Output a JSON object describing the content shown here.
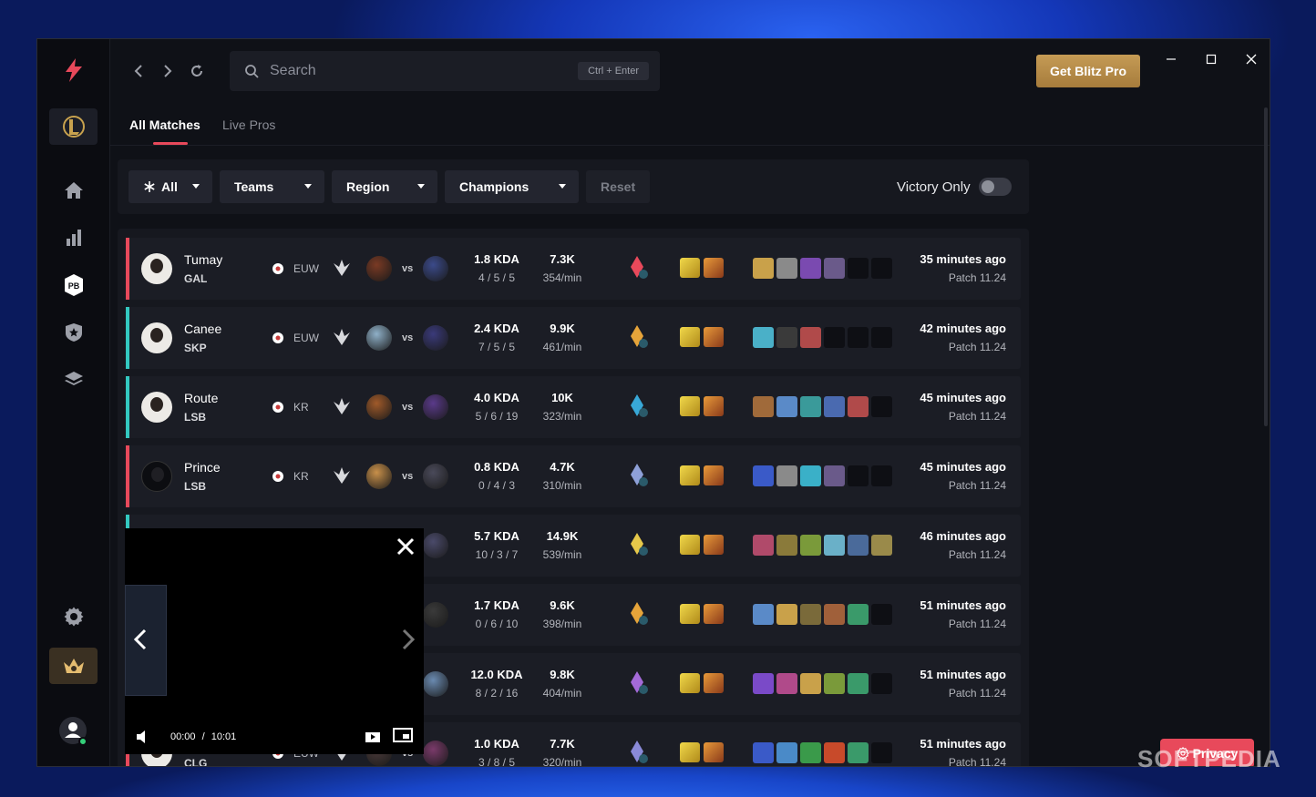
{
  "app": {
    "name": "Blitz"
  },
  "colors": {
    "accent": "#e8495b",
    "loss": "#e8495b",
    "win": "#33c8c0",
    "gold": "#c59b55",
    "bg": "#0f1117"
  },
  "sidebar": {
    "items": [
      {
        "icon": "blitz-logo-icon"
      },
      {
        "icon": "league-of-legends-icon"
      },
      {
        "icon": "home-icon"
      },
      {
        "icon": "stats-icon"
      },
      {
        "icon": "probuilds-icon",
        "label": "PB"
      },
      {
        "icon": "shield-star-icon"
      },
      {
        "icon": "layers-icon"
      },
      {
        "icon": "gear-icon"
      },
      {
        "icon": "crown-icon"
      },
      {
        "icon": "user-icon"
      }
    ]
  },
  "header": {
    "search_placeholder": "Search",
    "search_shortcut": "Ctrl + Enter",
    "get_pro": "Get Blitz Pro"
  },
  "tabs": [
    {
      "label": "All Matches",
      "active": true
    },
    {
      "label": "Live Pros",
      "active": false
    }
  ],
  "filters": {
    "all": "All",
    "teams": "Teams",
    "region": "Region",
    "champions": "Champions",
    "reset": "Reset",
    "victory_only": "Victory Only",
    "victory_on": false
  },
  "matches": [
    {
      "name": "Tumay",
      "team": "GAL",
      "region": "EUW",
      "result": "loss",
      "kda": "1.8 KDA",
      "kda_split": "4 / 5 / 5",
      "dmg": "7.3K",
      "dmg_rate": "354/min",
      "time": "35 minutes ago",
      "patch": "Patch 11.24"
    },
    {
      "name": "Canee",
      "team": "SKP",
      "region": "EUW",
      "result": "win",
      "kda": "2.4 KDA",
      "kda_split": "7 / 5 / 5",
      "dmg": "9.9K",
      "dmg_rate": "461/min",
      "time": "42 minutes ago",
      "patch": "Patch 11.24"
    },
    {
      "name": "Route",
      "team": "LSB",
      "region": "KR",
      "result": "win",
      "kda": "4.0 KDA",
      "kda_split": "5 / 6 / 19",
      "dmg": "10K",
      "dmg_rate": "323/min",
      "time": "45 minutes ago",
      "patch": "Patch 11.24"
    },
    {
      "name": "Prince",
      "team": "LSB",
      "region": "KR",
      "result": "loss",
      "kda": "0.8 KDA",
      "kda_split": "0 / 4 / 3",
      "dmg": "4.7K",
      "dmg_rate": "310/min",
      "time": "45 minutes ago",
      "patch": "Patch 11.24"
    },
    {
      "name": "",
      "team": "",
      "region": "",
      "result": "win",
      "kda": "5.7 KDA",
      "kda_split": "10 / 3 / 7",
      "dmg": "14.9K",
      "dmg_rate": "539/min",
      "time": "46 minutes ago",
      "patch": "Patch 11.24"
    },
    {
      "name": "",
      "team": "",
      "region": "",
      "result": "loss",
      "kda": "1.7 KDA",
      "kda_split": "0 / 6 / 10",
      "dmg": "9.6K",
      "dmg_rate": "398/min",
      "time": "51 minutes ago",
      "patch": "Patch 11.24"
    },
    {
      "name": "",
      "team": "",
      "region": "",
      "result": "loss",
      "kda": "12.0 KDA",
      "kda_split": "8 / 2 / 16",
      "dmg": "9.8K",
      "dmg_rate": "404/min",
      "time": "51 minutes ago",
      "patch": "Patch 11.24"
    },
    {
      "name": "",
      "team": "CLG",
      "region": "EUW",
      "result": "loss",
      "kda": "1.0 KDA",
      "kda_split": "3 / 8 / 5",
      "dmg": "7.7K",
      "dmg_rate": "320/min",
      "time": "51 minutes ago",
      "patch": "Patch 11.24"
    }
  ],
  "vs_label": "vs",
  "video": {
    "current": "00:00",
    "sep": "/",
    "duration": "10:01"
  },
  "privacy": "Privacy",
  "watermark": "SOFTPEDIA"
}
